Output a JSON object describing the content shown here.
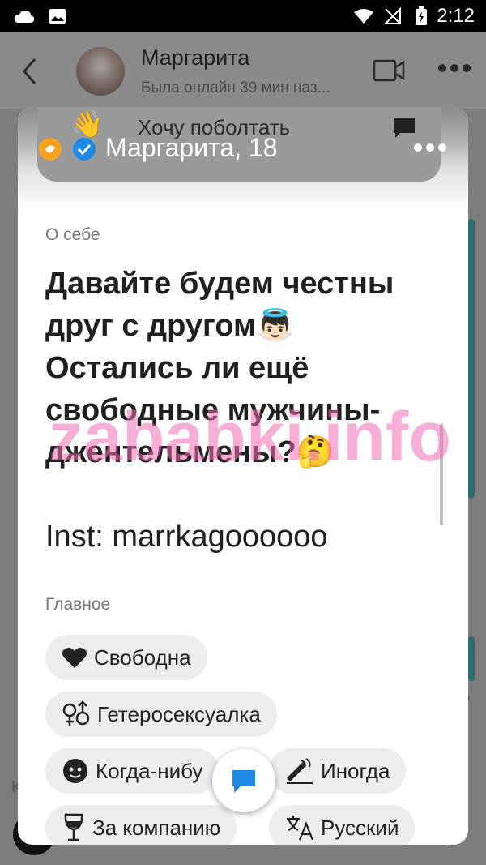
{
  "status_bar": {
    "time": "2:12"
  },
  "chat_header": {
    "name": "Маргарита",
    "status": "Была онлайн 39 мин наз..."
  },
  "background": {
    "bubble_text": "Хочу поболтать",
    "bubble_emoji": "👋",
    "side_fragment": "о",
    "left_fragment": "К"
  },
  "card": {
    "title": "Маргарита, 18",
    "about_label": "О себе",
    "bio_lines": [
      "Давайте будем честны",
      "друг с другом👼🏻",
      "Остались ли ещё",
      "свободные мужчины-",
      "джентельмены?🤔",
      "",
      "Inst: marrkagoooooo"
    ],
    "main_label": "Главное",
    "chips": [
      {
        "label": "Свободна",
        "icon": "heart-icon"
      },
      {
        "label": "Гетеросексуалка",
        "icon": "orientation-icon"
      },
      {
        "label": "Когда-нибу",
        "icon": "baby-icon"
      },
      {
        "label": "Иногда",
        "icon": "cigarette-icon"
      },
      {
        "label": "За компанию",
        "icon": "wine-glass-icon"
      },
      {
        "label": "Русский",
        "icon": "translate-icon"
      }
    ]
  },
  "watermark": "zababki.info",
  "colors": {
    "accent": "#1e88e5",
    "chip_bg": "#ededed",
    "teal": "#2a6c73"
  }
}
